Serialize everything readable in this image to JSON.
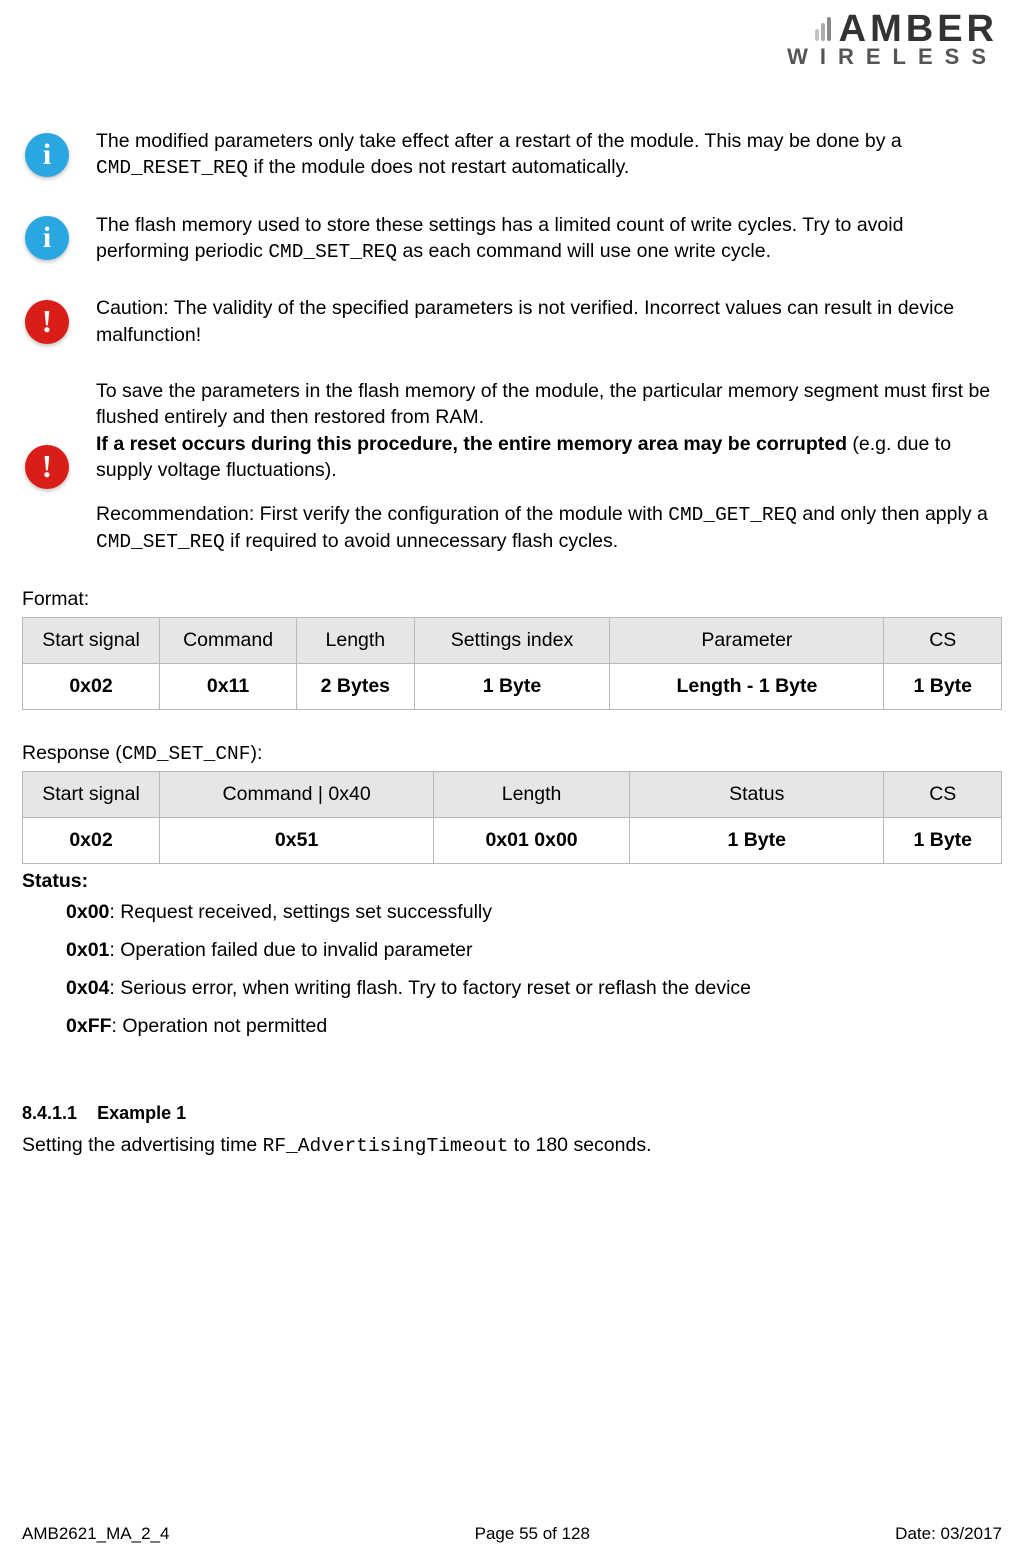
{
  "logo": {
    "line1": "AMBER",
    "line2": "WIRELESS"
  },
  "callouts": {
    "c1": {
      "pre": "The modified parameters only take effect after a restart of the module. This may be done by a ",
      "code": "CMD_RESET_REQ",
      "post": " if the module does not restart automatically."
    },
    "c2": {
      "pre": "The flash memory used to store these settings has a limited count of write cycles. Try to avoid performing periodic ",
      "code": "CMD_SET_REQ",
      "post": " as each command will use one write cycle."
    },
    "c3": {
      "text": "Caution: The validity of the specified parameters is not verified. Incorrect values can result in device malfunction!"
    },
    "c4": {
      "p1": "To save the parameters in the flash memory of the module, the particular memory segment must first be flushed entirely and then restored from RAM.",
      "bold": "If a reset occurs during this procedure, the entire memory area may be corrupted",
      "boldTail": " (e.g. due to supply voltage fluctuations).",
      "recPre": "Recommendation: First verify the configuration of the module with ",
      "recCode1": "CMD_GET_REQ",
      "recMid": " and only then apply a ",
      "recCode2": "CMD_SET_REQ",
      "recPost": " if required to avoid unnecessary flash cycles."
    }
  },
  "formatLabel": "Format:",
  "formatTable": {
    "headers": [
      "Start signal",
      "Command",
      "Length",
      "Settings index",
      "Parameter",
      "CS"
    ],
    "row": [
      "0x02",
      "0x11",
      "2 Bytes",
      "1 Byte",
      "Length - 1 Byte",
      "1 Byte"
    ]
  },
  "responseLabel": {
    "pre": "Response (",
    "code": "CMD_SET_CNF",
    "post": "):"
  },
  "responseTable": {
    "headers": [
      "Start signal",
      "Command | 0x40",
      "Length",
      "Status",
      "CS"
    ],
    "row": [
      "0x02",
      "0x51",
      "0x01 0x00",
      "1 Byte",
      "1 Byte"
    ]
  },
  "status": {
    "title": "Status:",
    "items": [
      {
        "code": "0x00",
        "text": ": Request received, settings set successfully"
      },
      {
        "code": "0x01",
        "text": ": Operation failed due to invalid parameter"
      },
      {
        "code": "0x04",
        "text": ": Serious error, when writing flash. Try to factory reset or reflash the device"
      },
      {
        "code": "0xFF",
        "text": ": Operation not permitted"
      }
    ]
  },
  "example": {
    "headingNum": "8.4.1.1",
    "headingText": "Example 1",
    "pre": "Setting the advertising time ",
    "code": "RF_AdvertisingTimeout",
    "post": " to 180 seconds."
  },
  "footer": {
    "left": "AMB2621_MA_2_4",
    "center": "Page 55 of 128",
    "right": "Date: 03/2017"
  }
}
